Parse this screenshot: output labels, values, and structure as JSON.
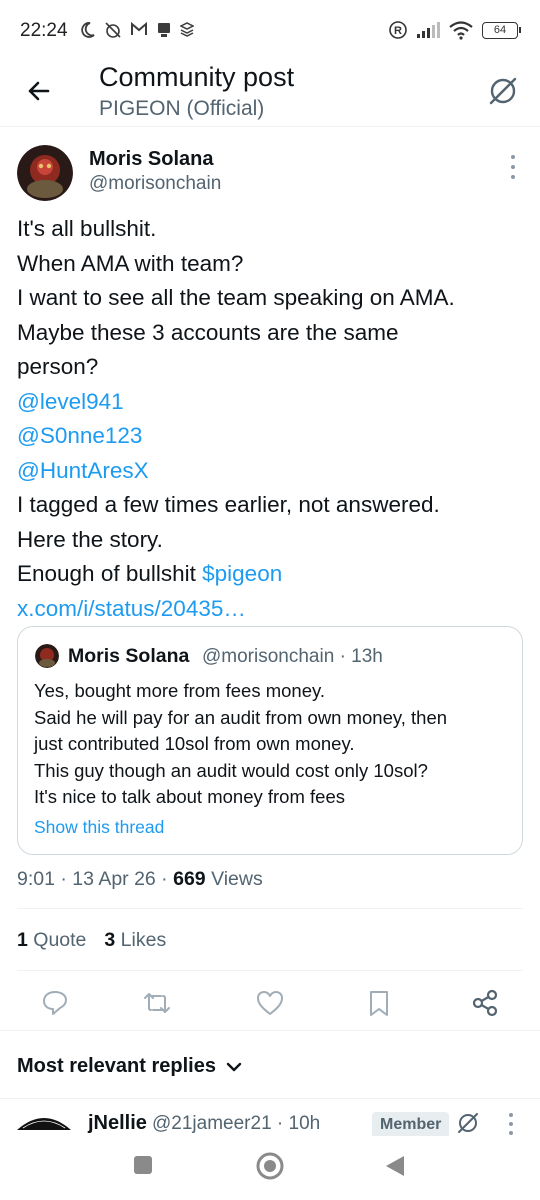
{
  "status_bar": {
    "time": "22:24",
    "icons_left": [
      "moon-icon",
      "alarm-off-icon",
      "gmail-icon",
      "notification-icon",
      "stack-icon"
    ],
    "icons_right": [
      "registered-icon",
      "signal-icon",
      "wifi-icon"
    ],
    "battery": "64"
  },
  "header": {
    "title": "Community post",
    "subtitle": "PIGEON (Official)"
  },
  "post": {
    "author_name": "Moris Solana",
    "author_handle": "@morisonchain",
    "lines": [
      {
        "text": "It's all bullshit.",
        "link": ""
      },
      {
        "text": "When AMA with team?",
        "link": ""
      },
      {
        "text": "I want to see all the team speaking on AMA.",
        "link": ""
      },
      {
        "text": "Maybe these 3 accounts are the same",
        "link": ""
      },
      {
        "text": "person?",
        "link": ""
      },
      {
        "text": "",
        "link": "@level941"
      },
      {
        "text": "",
        "link": "@S0nne123"
      },
      {
        "text": "",
        "link": "@HuntAresX"
      },
      {
        "text": "I tagged a few times earlier, not answered.",
        "link": ""
      },
      {
        "text": "Here the story.",
        "link": ""
      },
      {
        "text": "Enough of bullshit ",
        "link": "$pigeon"
      },
      {
        "text": "",
        "link": "x.com/i/status/20435…"
      }
    ],
    "quote": {
      "author_name": "Moris Solana",
      "meta": "@morisonchain · 13h",
      "lines": [
        "Yes, bought more from fees money.",
        "Said he will pay for an audit from own money, then",
        "just contributed 10sol from own money.",
        "This guy though an audit would cost only 10sol?",
        "It's nice to talk about money from fees"
      ],
      "show_thread": "Show this thread"
    },
    "time_date": "9:01 · 13 Apr 26 · ",
    "views_count": "669",
    "views_label": " Views",
    "quotes_count": "1",
    "quotes_label": " Quote",
    "likes_count": "3",
    "likes_label": " Likes"
  },
  "replies": {
    "sort_label": "Most relevant replies",
    "first_reply": {
      "name": "jNellie",
      "meta": "@21jameer21 · 10h",
      "badge": "Member"
    }
  },
  "colors": {
    "link": "#1d9bf0",
    "secondary_text": "#536471",
    "primary_text": "#0f1419"
  }
}
